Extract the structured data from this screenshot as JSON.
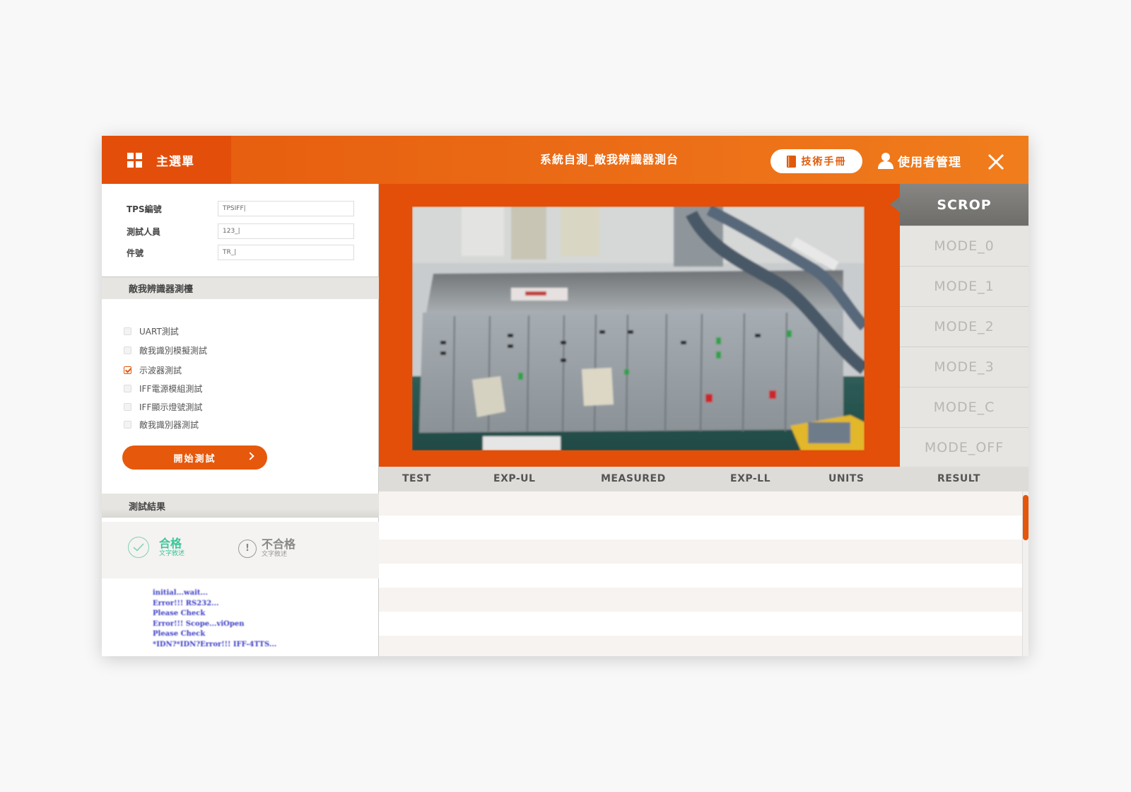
{
  "header": {
    "menu_label": "主選單",
    "title": "系統自測_敵我辨識器測台",
    "manual_label": "技術手冊",
    "user_label": "使用者管理"
  },
  "form": {
    "tps": {
      "label": "TPS編號",
      "value": "TPSIFF|"
    },
    "tester": {
      "label": "測試人員",
      "value": "123_|"
    },
    "part": {
      "label": "件號",
      "value": "TR_|"
    }
  },
  "tests": {
    "heading": "敵我辨識器測檯",
    "items": [
      {
        "label": "UART測試",
        "checked": false
      },
      {
        "label": "敵我識別模擬測試",
        "checked": false
      },
      {
        "label": "示波器測試",
        "checked": true
      },
      {
        "label": "IFF電源模組測試",
        "checked": false
      },
      {
        "label": "IFF顯示燈號測試",
        "checked": false
      },
      {
        "label": "敵我識別器測試",
        "checked": false
      }
    ],
    "start_label": "開始測試"
  },
  "results": {
    "heading": "測試結果",
    "pass_title": "合格",
    "pass_sub": "文字敘述",
    "fail_title": "不合格",
    "fail_sub": "文字敘述",
    "fail_icon": "!"
  },
  "log": [
    "initial...wait...",
    "Error!!! RS232...",
    "Please Check",
    "Error!!! Scope...viOpen",
    "Please Check",
    "*IDN?*IDN?Error!!! IFF-4TTS..."
  ],
  "modes": [
    "SCROP",
    "MODE_0",
    "MODE_1",
    "MODE_2",
    "MODE_3",
    "MODE_C",
    "MODE_OFF"
  ],
  "active_mode": "SCROP",
  "table": {
    "columns": [
      "TEST",
      "EXP-UL",
      "MEASURED",
      "EXP-LL",
      "UNITS",
      "RESULT"
    ],
    "rows": []
  },
  "colors": {
    "brand_orange": "#e55a0d",
    "pass_green": "#3cc69a",
    "fail_gray": "#999999",
    "log_blue": "#3d3fc8"
  },
  "icons": [
    "grid-menu-icon",
    "book-icon",
    "user-icon",
    "close-icon",
    "chevron-right-icon",
    "check-circle-icon",
    "exclamation-circle-icon"
  ]
}
